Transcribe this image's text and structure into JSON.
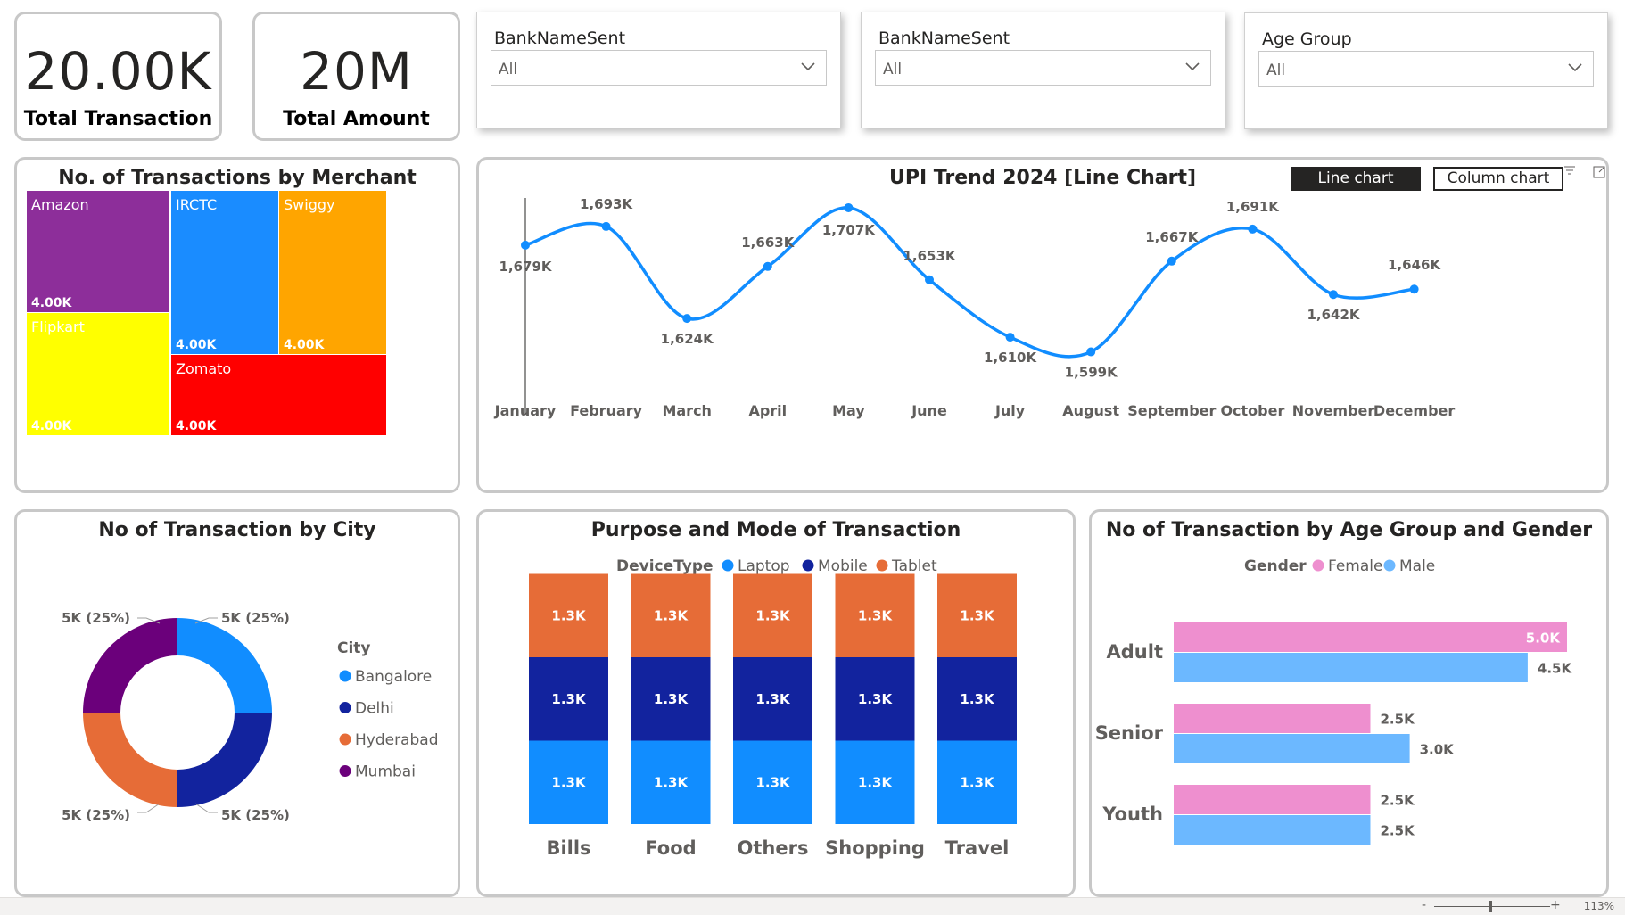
{
  "kpis": [
    {
      "value": "20.00K",
      "label": "Total Transaction"
    },
    {
      "value": "20M",
      "label": "Total Amount"
    }
  ],
  "slicers": [
    {
      "title": "BankNameSent",
      "value": "All"
    },
    {
      "title": "BankNameSent",
      "value": "All"
    },
    {
      "title": "Age Group",
      "value": "All"
    }
  ],
  "treemap": {
    "title": "No. of Transactions by Merchant",
    "items": [
      {
        "name": "Amazon",
        "value": "4.00K",
        "color": "#8d2e9a"
      },
      {
        "name": "IRCTC",
        "value": "4.00K",
        "color": "#1a8cff"
      },
      {
        "name": "Swiggy",
        "value": "4.00K",
        "color": "#ffa500"
      },
      {
        "name": "Flipkart",
        "value": "4.00K",
        "color": "#ffff00"
      },
      {
        "name": "Zomato",
        "value": "4.00K",
        "color": "#ff0000"
      }
    ]
  },
  "trend": {
    "title": "UPI Trend 2024 [Line Chart]",
    "buttons": {
      "line": "Line chart",
      "column": "Column chart"
    }
  },
  "donut_card": {
    "title": "No of Transaction by City",
    "legend_title": "City"
  },
  "stacked_card": {
    "title": "Purpose and Mode of Transaction",
    "legend_title": "DeviceType"
  },
  "bar_card": {
    "title": "No of Transaction by Age Group and Gender",
    "legend_title": "Gender"
  },
  "statusbar": {
    "zoom": "113%"
  },
  "chart_data": [
    {
      "type": "line",
      "title": "UPI Trend 2024 [Line Chart]",
      "categories": [
        "January",
        "February",
        "March",
        "April",
        "May",
        "June",
        "July",
        "August",
        "September",
        "October",
        "November",
        "December"
      ],
      "values": [
        1679,
        1693,
        1624,
        1663,
        1707,
        1653,
        1610,
        1599,
        1667,
        1691,
        1642,
        1646
      ],
      "labels": [
        "1,679K",
        "1,693K",
        "1,624K",
        "1,663K",
        "1,707K",
        "1,653K",
        "1,610K",
        "1,599K",
        "1,667K",
        "1,691K",
        "1,642K",
        "1,646K"
      ],
      "ylim": [
        1590,
        1715
      ],
      "color": "#118dff"
    },
    {
      "type": "pie",
      "title": "No of Transaction by City",
      "legend_title": "City",
      "categories": [
        "Bangalore",
        "Delhi",
        "Hyderabad",
        "Mumbai"
      ],
      "values": [
        5000,
        5000,
        5000,
        5000
      ],
      "labels": [
        "5K (25%)",
        "5K (25%)",
        "5K (25%)",
        "5K (25%)"
      ],
      "colors": [
        "#118dff",
        "#12239e",
        "#e66c37",
        "#6b007b"
      ]
    },
    {
      "type": "bar",
      "stacked": true,
      "title": "Purpose and Mode of Transaction",
      "legend_title": "DeviceType",
      "categories": [
        "Bills",
        "Food",
        "Others",
        "Shopping",
        "Travel"
      ],
      "series": [
        {
          "name": "Laptop",
          "color": "#118dff",
          "values": [
            1300,
            1300,
            1300,
            1300,
            1300
          ],
          "labels": [
            "1.3K",
            "1.3K",
            "1.3K",
            "1.3K",
            "1.3K"
          ]
        },
        {
          "name": "Mobile",
          "color": "#12239e",
          "values": [
            1300,
            1300,
            1300,
            1300,
            1300
          ],
          "labels": [
            "1.3K",
            "1.3K",
            "1.3K",
            "1.3K",
            "1.3K"
          ]
        },
        {
          "name": "Tablet",
          "color": "#e66c37",
          "values": [
            1300,
            1300,
            1300,
            1300,
            1300
          ],
          "labels": [
            "1.3K",
            "1.3K",
            "1.3K",
            "1.3K",
            "1.3K"
          ]
        }
      ]
    },
    {
      "type": "bar",
      "orientation": "horizontal",
      "title": "No of Transaction by Age Group and Gender",
      "legend_title": "Gender",
      "categories": [
        "Adult",
        "Senior",
        "Youth"
      ],
      "xlim": [
        0,
        5000
      ],
      "series": [
        {
          "name": "Female",
          "color": "#ee8fcf",
          "values": [
            5000,
            2500,
            2500
          ],
          "labels": [
            "5.0K",
            "2.5K",
            "2.5K"
          ]
        },
        {
          "name": "Male",
          "color": "#6cb8ff",
          "values": [
            4500,
            3000,
            2500
          ],
          "labels": [
            "4.5K",
            "3.0K",
            "2.5K"
          ]
        }
      ]
    }
  ]
}
